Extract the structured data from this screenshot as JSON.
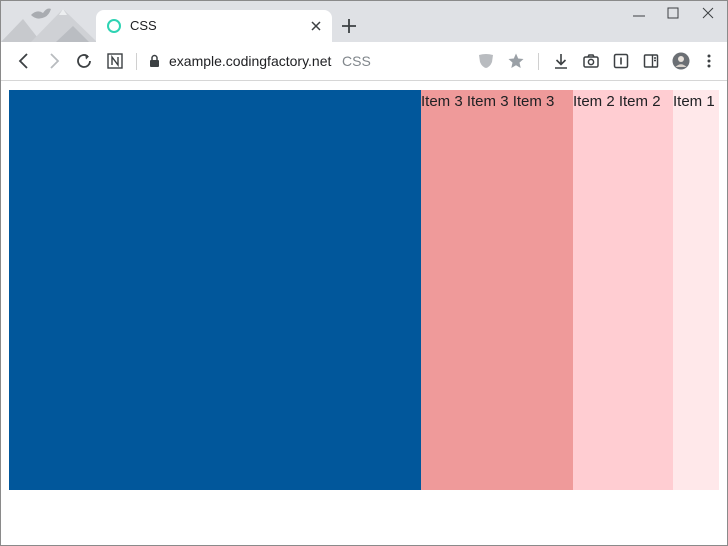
{
  "browser": {
    "tab": {
      "title": "CSS",
      "favicon": "circle-favicon-icon"
    },
    "address_bar": {
      "host": "example.codingfactory.net",
      "page_title": "CSS"
    },
    "icons": [
      "back-icon",
      "forward-icon",
      "reload-icon",
      "notion-icon",
      "lock-icon",
      "shield-icon",
      "star-icon",
      "download-icon",
      "camera-icon",
      "reader-icon",
      "sidebar-icon",
      "profile-avatar",
      "menu-icon"
    ]
  },
  "page": {
    "items": [
      {
        "text": "Item 1",
        "color": "#ffe8ea"
      },
      {
        "text": "Item 2 Item 2",
        "color": "#ffcdd2"
      },
      {
        "text": "Item 3 Item 3 Item 3",
        "color": "#ef9a9a"
      },
      {
        "text": "",
        "color": "#01579b"
      }
    ]
  }
}
